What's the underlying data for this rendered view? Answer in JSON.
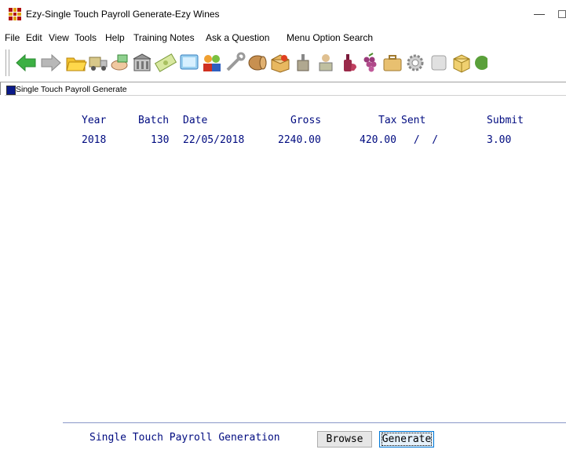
{
  "window": {
    "title": "Ezy-Single Touch Payroll Generate-Ezy Wines",
    "minimize": "—"
  },
  "menu": [
    "File",
    "Edit",
    "View",
    "Tools",
    "Help",
    "Training Notes",
    "Ask a Question",
    "Menu Option Search"
  ],
  "toolbar_icons": [
    "back-arrow-icon",
    "forward-arrow-icon",
    "folder-open-icon",
    "delivery-icon",
    "hand-money-icon",
    "building-icon",
    "banknote-icon",
    "screen-icon",
    "people-icon",
    "wrench-icon",
    "barrel-icon",
    "parcel-icon",
    "wine-press-icon",
    "picker-icon",
    "wine-bottle-icon",
    "grapes-icon",
    "briefcase-icon",
    "gear-icon",
    "blank-icon",
    "box-icon",
    "vine-leaf-icon"
  ],
  "panel": {
    "title": "Single Touch Payroll Generate"
  },
  "table": {
    "headers": {
      "year": "Year",
      "batch": "Batch",
      "date": "Date",
      "gross": "Gross",
      "tax": "Tax",
      "sent": "Sent",
      "submit": "Submit"
    },
    "rows": [
      {
        "year": "2018",
        "batch": "130",
        "date": "22/05/2018",
        "gross": "2240.00",
        "tax": "420.00",
        "sent": " /  /",
        "submit": "3.00"
      }
    ]
  },
  "footer": {
    "label": "Single Touch Payroll Generation",
    "browse": "Browse",
    "generate": "Generate"
  },
  "colors": {
    "text_blue": "#000b80",
    "panel_icon": "#0a1a8a"
  }
}
